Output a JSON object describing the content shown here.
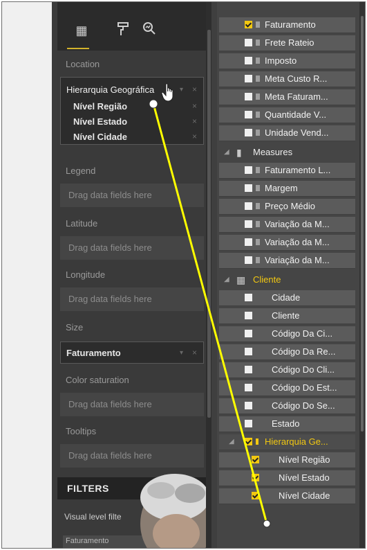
{
  "visualizations": {
    "tabs": [
      {
        "name": "fields-tab-icon",
        "glyph": "▦"
      },
      {
        "name": "format-tab-icon",
        "glyph": "🖌"
      },
      {
        "name": "analytics-tab-icon",
        "glyph": "🔍"
      }
    ],
    "location_label": "Location",
    "location_fields": [
      "Hierarquia Geográfica",
      "Nível Região",
      "Nível Estado",
      "Nível Cidade"
    ],
    "legend_label": "Legend",
    "latitude_label": "Latitude",
    "longitude_label": "Longitude",
    "size_label": "Size",
    "size_value": "Faturamento",
    "color_sat_label": "Color saturation",
    "tooltips_label": "Tooltips",
    "placeholder": "Drag data fields here",
    "remove_glyph": "×",
    "chevron_glyph": "▾"
  },
  "filters": {
    "title": "FILTERS",
    "visual_level": "Visual level filte",
    "first_filter": "Faturamento"
  },
  "fields": {
    "top_items": [
      {
        "label": "Faturamento",
        "checked": true
      },
      {
        "label": "Frete Rateio",
        "checked": false
      },
      {
        "label": "Imposto",
        "checked": false
      },
      {
        "label": "Meta Custo R...",
        "checked": false
      },
      {
        "label": "Meta Faturam...",
        "checked": false
      },
      {
        "label": "Quantidade V...",
        "checked": false
      },
      {
        "label": "Unidade Vend...",
        "checked": false
      }
    ],
    "measures_group": "Measures",
    "measures": [
      "Faturamento L...",
      "Margem",
      "Preço Médio",
      "Variação da M...",
      "Variação da M...",
      "Variação da M..."
    ],
    "cliente_group": "Cliente",
    "cliente_items": [
      "Cidade",
      "Cliente",
      "Código Da Ci...",
      "Código Da Re...",
      "Código Do Cli...",
      "Código Do Est...",
      "Código Do Se...",
      "Estado"
    ],
    "hierarchy_group": "Hierarquia Ge...",
    "hierarchy_levels": [
      "Nível Região",
      "Nível Estado",
      "Nível Cidade"
    ]
  },
  "colors": {
    "accent": "#f2c811",
    "drag_line": "#ffff00"
  }
}
